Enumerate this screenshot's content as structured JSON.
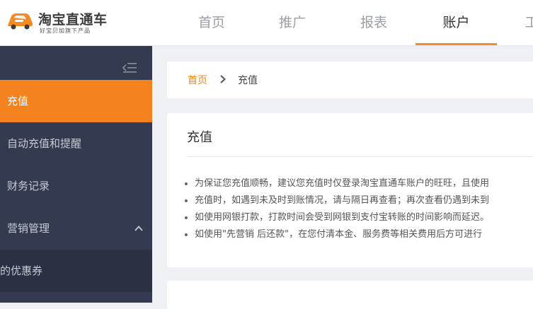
{
  "brand": {
    "title": "淘宝直通车",
    "subtitle": "好宝贝加旗下产品",
    "accent_color": "#f38a24",
    "logo_icon": "car-icon"
  },
  "nav": {
    "items": [
      {
        "label": "首页",
        "active": false
      },
      {
        "label": "推广",
        "active": false
      },
      {
        "label": "报表",
        "active": false
      },
      {
        "label": "账户",
        "active": true
      },
      {
        "label": "工",
        "active": false
      }
    ]
  },
  "sidebar": {
    "collapse_icon": "collapse-menu-icon",
    "items": [
      {
        "label": "充值",
        "active": true
      },
      {
        "label": "自动充值和提醒",
        "active": false
      },
      {
        "label": "财务记录",
        "active": false
      },
      {
        "label": "营销管理",
        "active": false,
        "icon": "chevron-up-icon"
      },
      {
        "label": "的优惠券",
        "active": false
      }
    ]
  },
  "breadcrumb": {
    "home": "首页",
    "current": "充值",
    "separator_icon": "chevron-right-icon"
  },
  "content": {
    "title": "充值",
    "notes": [
      "为保证您充值顺畅，建议您充值时仅登录淘宝直通车账户的旺旺，且使用",
      "充值时，如遇到未及时到账情况，请与隔日再查看；再次查看仍遇到未到",
      "如使用网银打款，打款时间会受到网银到支付宝转账的时间影响而延迟。",
      "如使用\"先营销 后还款\"，在您付清本金、服务费等相关费用后方可进行"
    ]
  }
}
